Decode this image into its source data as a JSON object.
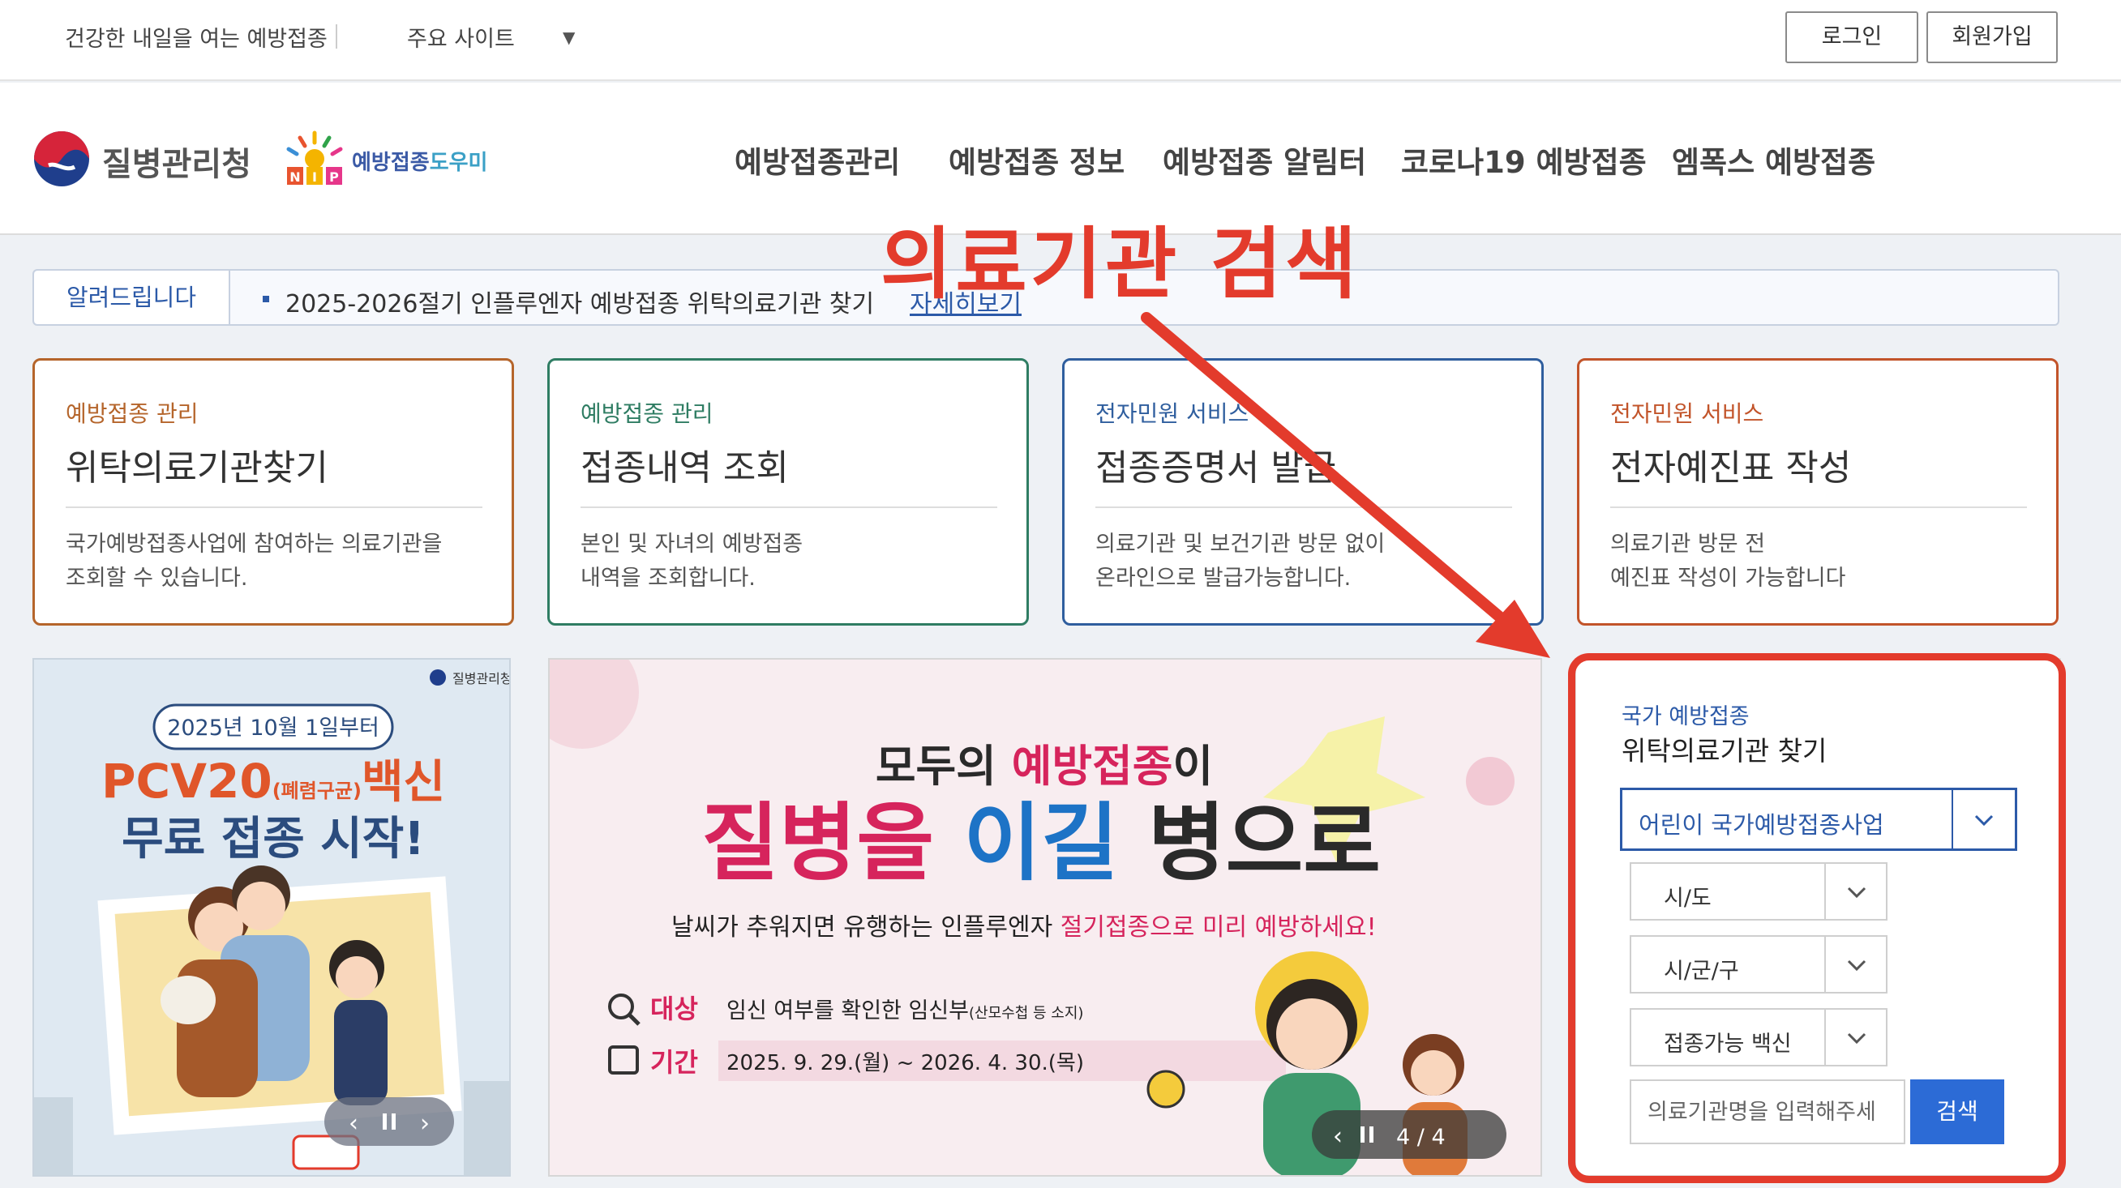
{
  "topbar": {
    "tagline": "건강한 내일을 여는 예방접종",
    "sites_label": "주요 사이트",
    "login": "로그인",
    "join": "회원가입"
  },
  "header": {
    "logo_kdca": "질병관리청",
    "logo_nip_main": "예방접종",
    "logo_nip_accent": "도우미",
    "logo_nip_badge": "NIP",
    "nav": [
      "예방접종관리",
      "예방접종 정보",
      "예방접종 알림터",
      "코로나19 예방접종",
      "엠폭스 예방접종"
    ]
  },
  "notice": {
    "label": "알려드립니다",
    "text": "2025-2026절기 인플루엔자 예방접종 위탁의료기관 찾기",
    "link": "자세히보기"
  },
  "cards": [
    {
      "category": "예방접종 관리",
      "title": "위탁의료기관찾기",
      "desc1": "국가예방접종사업에 참여하는 의료기관을",
      "desc2": "조회할 수 있습니다.",
      "color": "#b5652b"
    },
    {
      "category": "예방접종 관리",
      "title": "접종내역 조회",
      "desc1": "본인 및 자녀의 예방접종",
      "desc2": "내역을 조회합니다.",
      "color": "#2f7d63"
    },
    {
      "category": "전자민원 서비스",
      "title": "접종증명서 발급",
      "desc1": "의료기관 및 보건기관 방문 없이",
      "desc2": "온라인으로 발급가능합니다.",
      "color": "#2f5e9e"
    },
    {
      "category": "전자민원 서비스",
      "title": "전자예진표 작성",
      "desc1": "의료기관 방문 전",
      "desc2": "예진표 작성이 가능합니다",
      "color": "#c2542a"
    }
  ],
  "banner_left": {
    "org": "질병관리청",
    "date": "2025년 10월 1일부터",
    "headline1_a": "PCV20",
    "headline1_b": "(폐렴구균)",
    "headline1_c": "백신",
    "headline2": "무료 접종 시작!"
  },
  "banner_main": {
    "line1_a": "모두의 ",
    "line1_b": "예방접종",
    "line1_c": "이",
    "line2_a": "질병을 ",
    "line2_b": "이길",
    "line2_c": " 병으로",
    "sub_a": "날씨가 추워지면 유행하는 인플루엔자 ",
    "sub_b": "절기접종으로 미리 예방하세요!",
    "target_label": "대상",
    "target_value": "임신 여부를 확인한 임신부",
    "target_note": "(산모수첩 등 소지)",
    "period_label": "기간",
    "period_value": "2025. 9. 29.(월) ~ 2026. 4. 30.(목)",
    "counter": "4 / 4"
  },
  "search": {
    "category": "국가 예방접종",
    "title": "위탁의료기관 찾기",
    "program": "어린이 국가예방접종사업",
    "sido": "시/도",
    "sigungu": "시/군/구",
    "vaccine": "접종가능 백신",
    "input_placeholder": "의료기관명을 입력해주세",
    "button": "검색"
  },
  "annotation": {
    "title": "의료기관 검색",
    "color": "#e33b2c"
  }
}
